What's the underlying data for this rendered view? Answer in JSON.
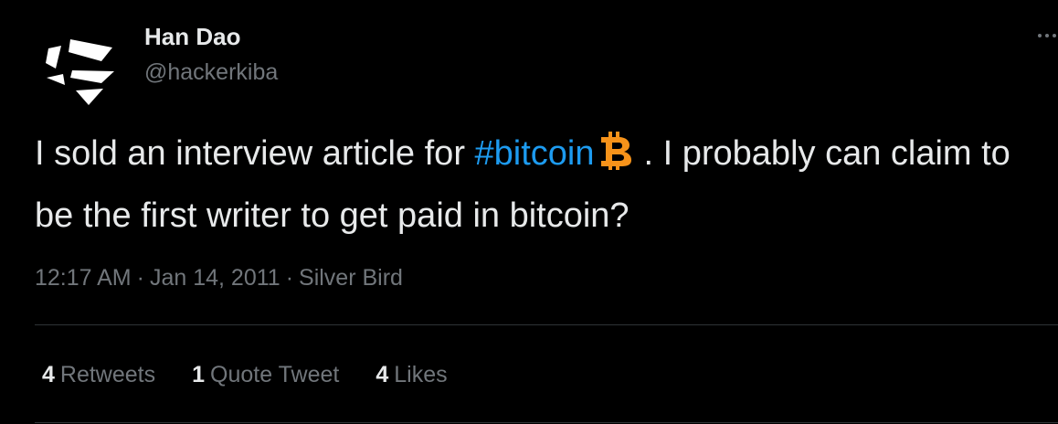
{
  "author": {
    "name": "Han Dao",
    "handle": "@hackerkiba"
  },
  "tweet": {
    "text_before": "I sold an interview article for ",
    "hashtag": "#bitcoin",
    "text_after": ". I probably can claim to be the first writer to get paid in bitcoin?"
  },
  "meta": {
    "time": "12:17 AM",
    "separator": "·",
    "date": "Jan 14, 2011",
    "source": "Silver Bird"
  },
  "stats": [
    {
      "count": "4",
      "label": "Retweets"
    },
    {
      "count": "1",
      "label": "Quote Tweet"
    },
    {
      "count": "4",
      "label": "Likes"
    }
  ],
  "colors": {
    "background": "#000000",
    "text": "#e7e9ea",
    "muted": "#71767b",
    "link": "#1d9bf0",
    "bitcoin": "#f7931a",
    "divider": "#2f3336"
  },
  "icons": {
    "avatar": "avatar-logo",
    "more": "more-dots-icon",
    "hashtag_emoji": "bitcoin-icon"
  }
}
